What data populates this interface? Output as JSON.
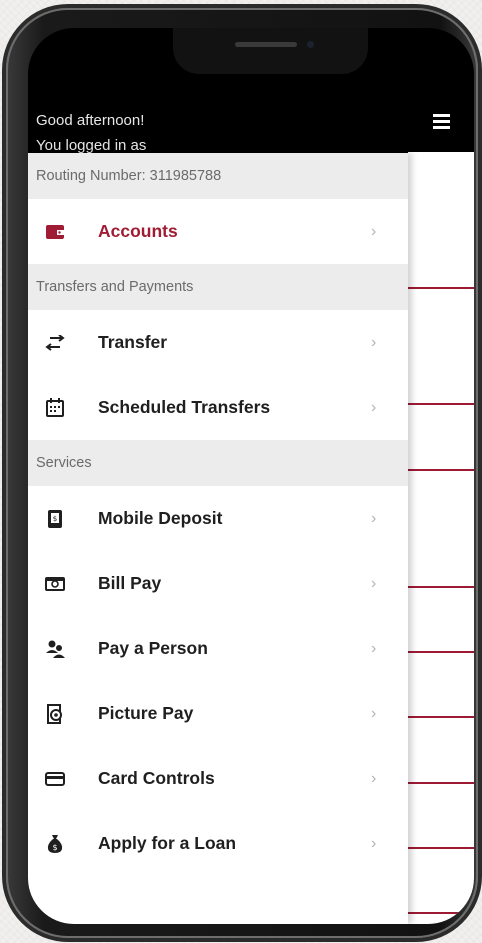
{
  "header": {
    "greeting": "Good afternoon!",
    "logged_in": "You logged in as"
  },
  "routing": "Routing Number: 311985788",
  "accounts": {
    "label": "Accounts",
    "accent": "#a01c34"
  },
  "transfers_section": "Transfers and Payments",
  "transfers": [
    {
      "label": "Transfer",
      "icon": "swap-arrows-icon"
    },
    {
      "label": "Scheduled Transfers",
      "icon": "calendar-icon"
    }
  ],
  "services_section": "Services",
  "services": [
    {
      "label": "Mobile Deposit",
      "icon": "check-deposit-icon"
    },
    {
      "label": "Bill Pay",
      "icon": "bill-cash-icon"
    },
    {
      "label": "Pay a Person",
      "icon": "people-icon"
    },
    {
      "label": "Picture Pay",
      "icon": "camera-bill-icon"
    },
    {
      "label": "Card Controls",
      "icon": "credit-card-icon"
    },
    {
      "label": "Apply for a Loan",
      "icon": "money-bag-icon"
    }
  ],
  "chevron": "›"
}
